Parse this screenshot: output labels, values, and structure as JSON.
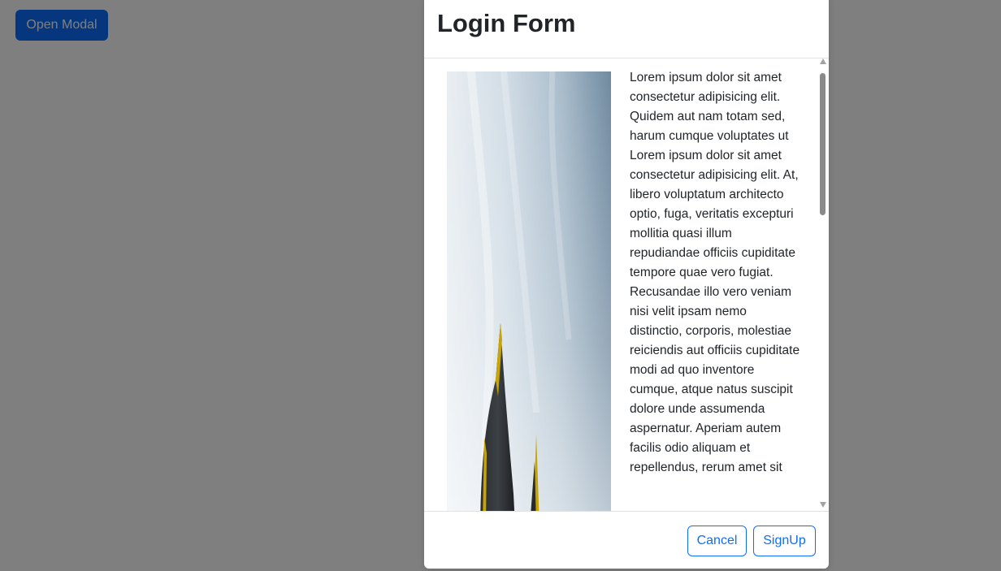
{
  "page": {
    "open_button_label": "Open Modal"
  },
  "modal": {
    "title": "Login Form",
    "body_text": "Lorem ipsum dolor sit amet consectetur adipisicing elit. Quidem aut nam totam sed, harum cumque voluptates ut Lorem ipsum dolor sit amet consectetur adipisicing elit. At, libero voluptatum architecto optio, fuga, veritatis excepturi mollitia quasi illum repudiandae officiis cupiditate tempore quae vero fugiat. Recusandae illo vero veniam nisi velit ipsam nemo distinctio, corporis, molestiae reiciendis aut officiis cupiditate modi ad quo inventore cumque, atque natus suscipit dolore unde assumenda aspernatur. Aperiam autem facilis odio aliquam et repellendus, rerum amet sit",
    "footer": {
      "cancel_label": "Cancel",
      "signup_label": "SignUp"
    }
  },
  "colors": {
    "primary": "#0d6efd",
    "backdrop": "#808080",
    "text": "#212529",
    "border": "#dee2e6"
  },
  "icons": {
    "scroll_up": "triangle-up-icon",
    "scroll_down": "triangle-down-icon"
  }
}
